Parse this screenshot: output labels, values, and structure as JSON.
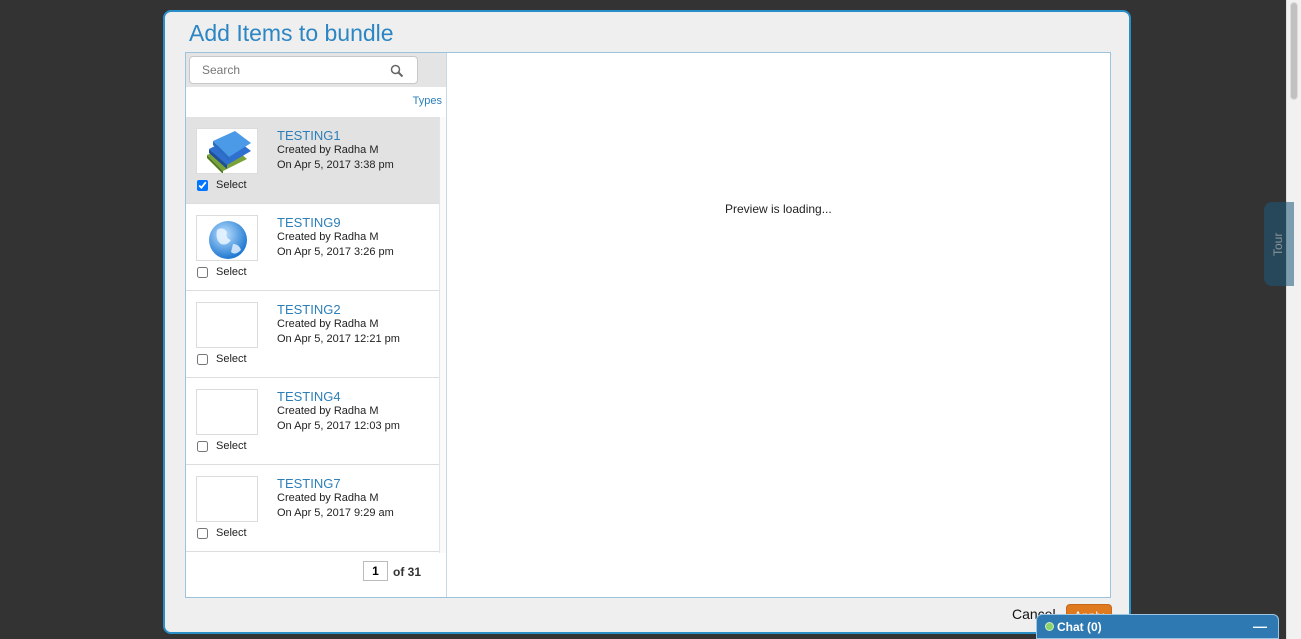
{
  "modal": {
    "title": "Add Items to bundle",
    "search_placeholder": "Search",
    "types_link": "Types",
    "preview_text": "Preview is loading...",
    "cancel_label": "Cancel",
    "apply_label": "Apply"
  },
  "items": [
    {
      "title": "TESTING1",
      "created_by": "Created by Radha M",
      "date": "On Apr 5, 2017 3:38 pm",
      "select_label": "Select",
      "checked": true,
      "thumbnail": "books-icon"
    },
    {
      "title": "TESTING9",
      "created_by": "Created by Radha M",
      "date": "On Apr 5, 2017 3:26 pm",
      "select_label": "Select",
      "checked": false,
      "thumbnail": "globe-icon"
    },
    {
      "title": "TESTING2",
      "created_by": "Created by Radha M",
      "date": "On Apr 5, 2017 12:21 pm",
      "select_label": "Select",
      "checked": false,
      "thumbnail": "empty"
    },
    {
      "title": "TESTING4",
      "created_by": "Created by Radha M",
      "date": "On Apr 5, 2017 12:03 pm",
      "select_label": "Select",
      "checked": false,
      "thumbnail": "empty"
    },
    {
      "title": "TESTING7",
      "created_by": "Created by Radha M",
      "date": "On Apr 5, 2017 9:29 am",
      "select_label": "Select",
      "checked": false,
      "thumbnail": "empty"
    }
  ],
  "pager": {
    "current_page": "1",
    "of_text": "of 31"
  },
  "tour_tab": {
    "label": "Tour"
  },
  "chat": {
    "label": "Chat  (0)",
    "minimize": "—"
  },
  "colors": {
    "accent": "#2c86c4",
    "apply": "#e07a1f",
    "chat_bar": "#2e79b2",
    "selected_row": "#e2e2e2"
  }
}
